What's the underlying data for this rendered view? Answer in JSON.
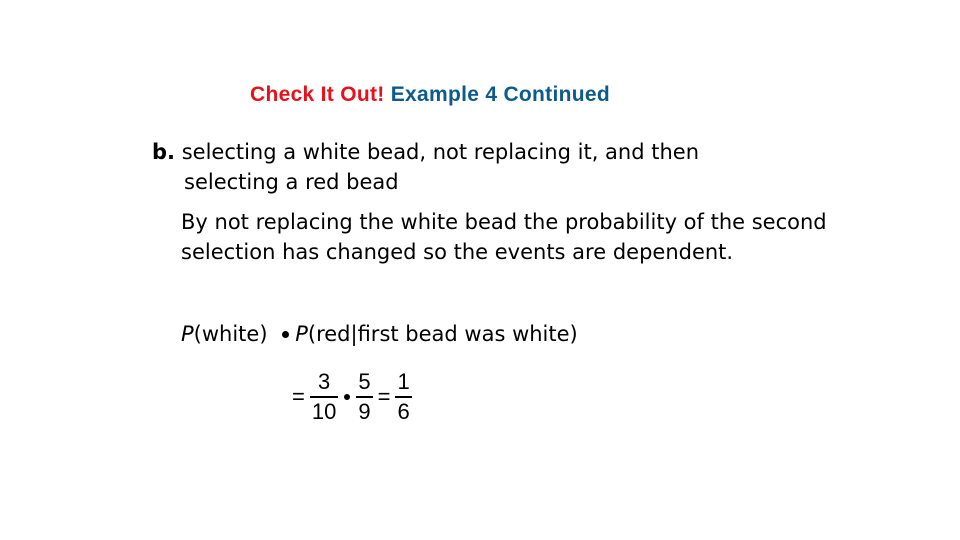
{
  "title": {
    "prefix": "Check It Out!",
    "suffix": "Example 4 Continued",
    "colors": {
      "prefix": "#e8101a",
      "suffix": "#0d5a8c"
    }
  },
  "part_b": {
    "label": "b.",
    "line1": "selecting a white bead, not replacing it, and then",
    "line2": "selecting a red bead"
  },
  "explanation": {
    "text": "By not replacing the white bead the probability of the second selection has changed so the events are dependent."
  },
  "probability_expression": {
    "p1_symbol": "P",
    "p1_arg": "(white)",
    "operator": "multiply-dot",
    "p2_symbol": "P",
    "p2_arg": "(red|first bead was white)"
  },
  "equation": {
    "equals": "=",
    "fraction1": {
      "numerator": "3",
      "denominator": "10"
    },
    "fraction2": {
      "numerator": "5",
      "denominator": "9"
    },
    "result": {
      "numerator": "1",
      "denominator": "6"
    }
  }
}
